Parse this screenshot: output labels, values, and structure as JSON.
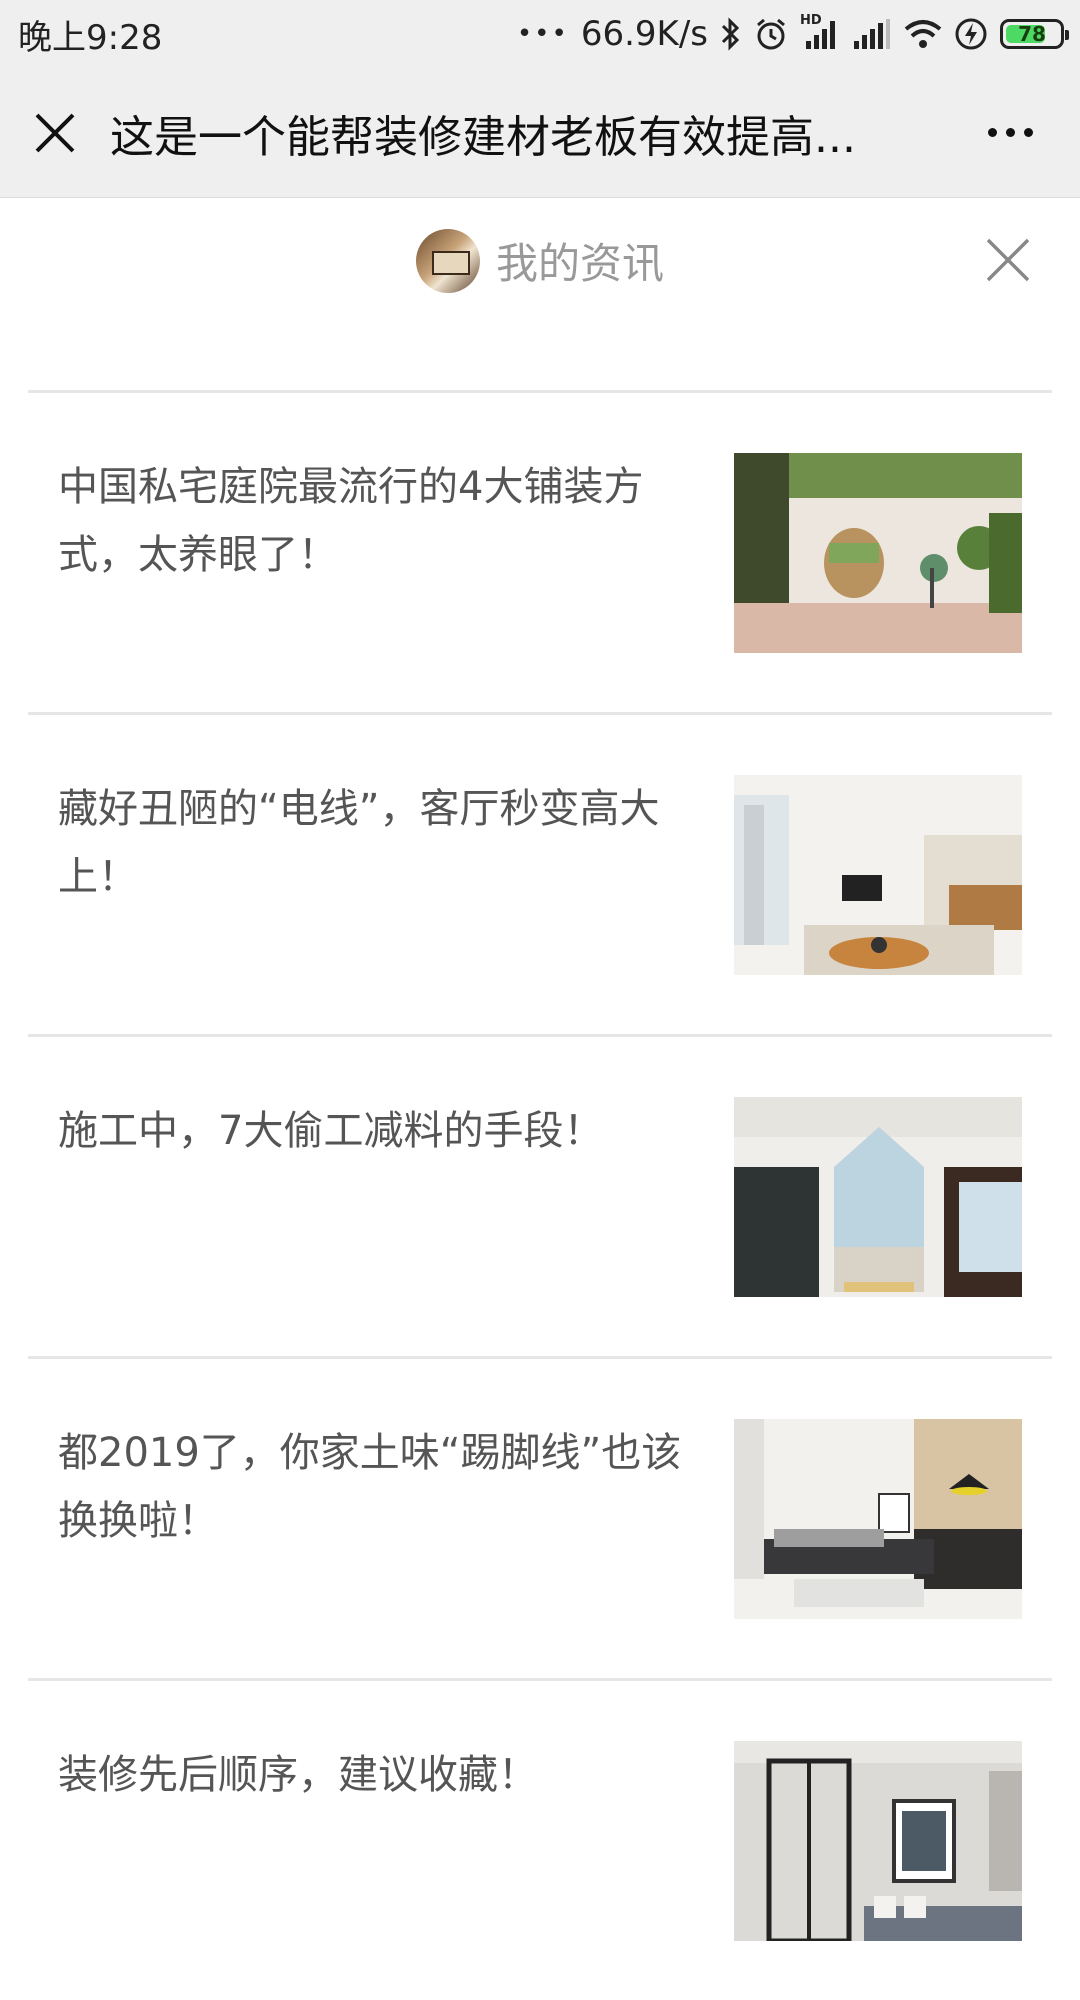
{
  "status_bar": {
    "time": "晚上9:28",
    "dots": "•••",
    "net_speed": "66.9K/s",
    "hd_label": "HD",
    "battery": "78"
  },
  "title_bar": {
    "title": "这是一个能帮装修建材老板有效提高..."
  },
  "panel": {
    "title": "我的资讯"
  },
  "articles": [
    {
      "title": "中国私宅庭院最流行的4大铺装方式，太养眼了！"
    },
    {
      "title": "藏好丑陋的“电线”，客厅秒变高大上！"
    },
    {
      "title": "施工中，7大偷工减料的手段！"
    },
    {
      "title": "都2019了，你家土味“踢脚线”也该换换啦！"
    },
    {
      "title": "装修先后顺序，建议收藏！"
    }
  ]
}
